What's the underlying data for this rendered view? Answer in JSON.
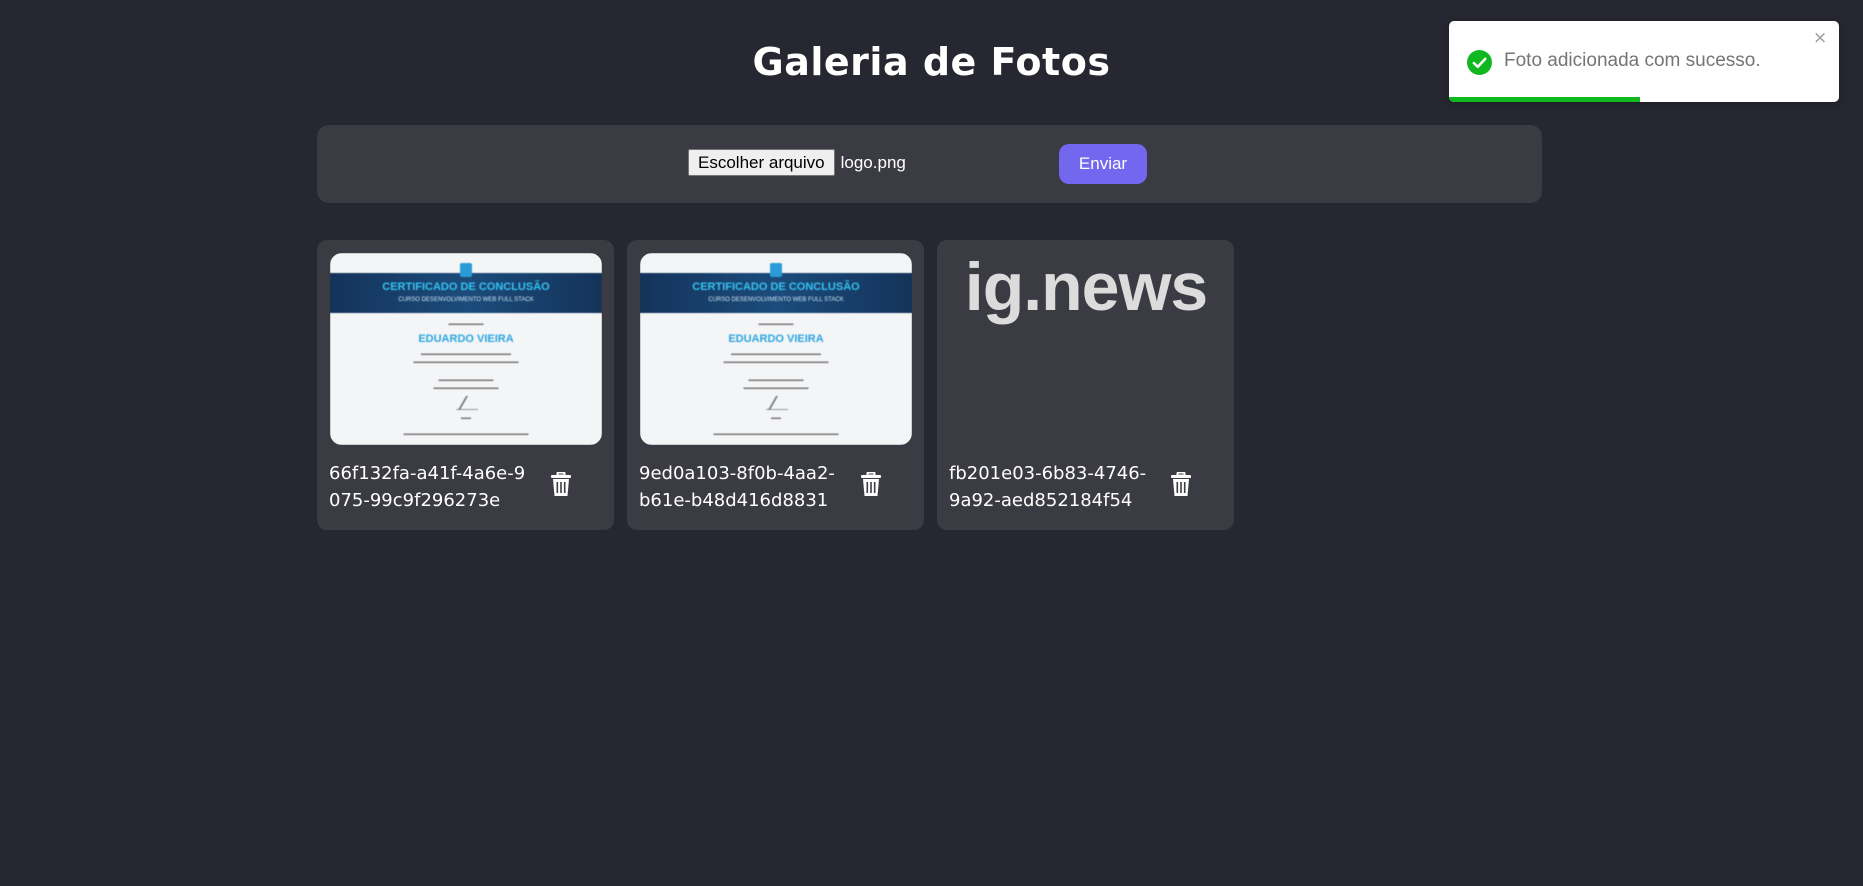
{
  "page": {
    "title": "Galeria de Fotos"
  },
  "upload": {
    "choose_file_label": "Escolher arquivo",
    "file_name": "logo.png",
    "send_label": "Enviar"
  },
  "photos": [
    {
      "id": "66f132fa-a41f-4a6e-9075-99c9f296273e",
      "image": "certificate",
      "cert_title": "CERTIFICADO DE CONCLUSÃO",
      "cert_subtitle": "CURSO DESENVOLVIMENTO WEB FULL STACK",
      "cert_name": "EDUARDO VIEIRA"
    },
    {
      "id": "9ed0a103-8f0b-4aa2-b61e-b48d416d8831",
      "image": "certificate",
      "cert_title": "CERTIFICADO DE CONCLUSÃO",
      "cert_subtitle": "CURSO DESENVOLVIMENTO WEB FULL STACK",
      "cert_name": "EDUARDO VIEIRA"
    },
    {
      "id": "fb201e03-6b83-4746-9a92-aed852184f54",
      "image": "logo",
      "logo_text": "ig.news"
    }
  ],
  "toast": {
    "message": "Foto adicionada com sucesso.",
    "close_symbol": "×",
    "progress": 0.49,
    "status_color": "#10b820"
  },
  "icons": {
    "delete": "trash-icon",
    "success": "check-circle-icon",
    "close": "close-icon"
  },
  "colors": {
    "background": "#262730",
    "panel": "#3b3c43",
    "accent": "#7367f0"
  }
}
